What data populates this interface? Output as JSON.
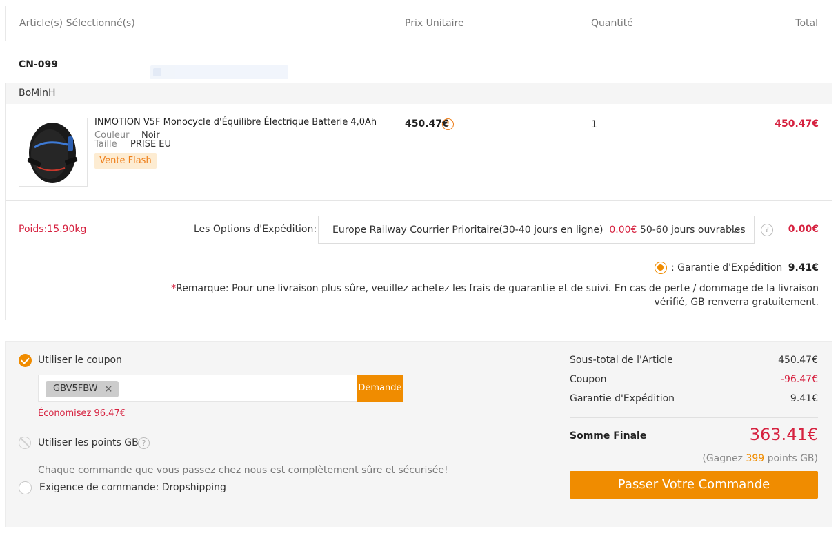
{
  "header": {
    "col_items": "Article(s) Sélectionné(s)",
    "col_unit_price": "Prix Unitaire",
    "col_quantity": "Quantité",
    "col_total": "Total"
  },
  "store": {
    "code": "CN-099",
    "seller": "BoMinH"
  },
  "product": {
    "title": "INMOTION V5F Monocycle d'Équilibre Électrique Batterie 4,0Ah",
    "attr_color_label": "Couleur",
    "attr_color_value": "Noir",
    "attr_size_label": "Taille",
    "attr_size_value": "PRISE EU",
    "badge": "Vente Flash",
    "unit_price": "450.47€",
    "warning_glyph": "!",
    "quantity": "1",
    "total": "450.47€",
    "image_icon": "electric-unicycle"
  },
  "shipping": {
    "weight": "Poids:15.90kg",
    "options_label": "Les Options d'Expédition:",
    "selected_method": "Europe Railway Courrier Prioritaire(30-40 jours en ligne)",
    "selected_price": "0.00€",
    "selected_delay": "50-60 jours ouvrables",
    "help_glyph": "?",
    "cost": "0.00€",
    "guarantee_label": ": Garantie d'Expédition",
    "guarantee_value": "9.41€",
    "remark_star": "*",
    "remark": "Remarque: Pour une livraison plus sûre, veuillez achetez les frais de guarantie et de suivi. En cas de perte / dommage de la livraison vérifié, GB renverra gratuitement."
  },
  "coupon": {
    "use_label": "Utiliser le coupon",
    "code": "GBV5FBW",
    "remove_glyph": "✕",
    "apply_label": "Demande",
    "savings": "Économisez 96.47€"
  },
  "points": {
    "use_label": "Utiliser les points GB",
    "help_glyph": "?"
  },
  "secure_note": "Chaque commande que vous passez chez nous est complètement sûre et sécurisée!",
  "dropshipping_label": "Exigence de commande: Dropshipping",
  "summary": {
    "subtotal_label": "Sous-total de l'Article",
    "subtotal_value": "450.47€",
    "coupon_label": "Coupon",
    "coupon_value": "-96.47€",
    "guarantee_label": "Garantie d'Expédition",
    "guarantee_value": "9.41€",
    "final_label": "Somme Finale",
    "final_value": "363.41€",
    "earn_prefix": "(Gagnez",
    "earn_points": "399",
    "earn_suffix": "points GB)",
    "order_button": "Passer Votre Commande"
  },
  "colors": {
    "accent_orange": "#f08c00",
    "price_red": "#d6213f",
    "flash_bg": "#fdecd2"
  }
}
